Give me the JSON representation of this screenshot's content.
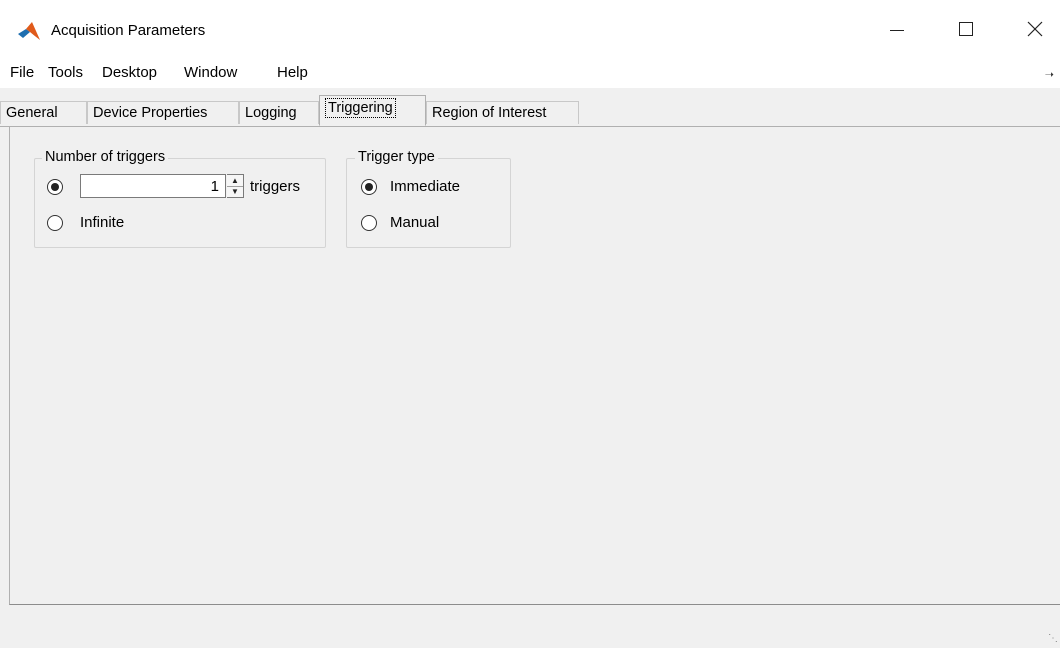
{
  "window": {
    "title": "Acquisition Parameters",
    "minimize_label": "",
    "maximize_label": "",
    "close_label": ""
  },
  "menu": {
    "items": [
      "File",
      "Tools",
      "Desktop",
      "Window",
      "Help"
    ]
  },
  "tabs": {
    "items": [
      "General",
      "Device Properties",
      "Logging",
      "Triggering",
      "Region of Interest"
    ],
    "selected": "Triggering"
  },
  "number_of_triggers": {
    "legend": "Number of triggers",
    "count_value": "1",
    "count_unit": "triggers",
    "infinite_label": "Infinite",
    "selected": "count"
  },
  "trigger_type": {
    "legend": "Trigger type",
    "options": [
      "Immediate",
      "Manual"
    ],
    "selected": "Immediate"
  },
  "icons": {
    "app": "matlab-icon",
    "spin_up": "up-arrow-icon",
    "spin_down": "down-arrow-icon"
  }
}
